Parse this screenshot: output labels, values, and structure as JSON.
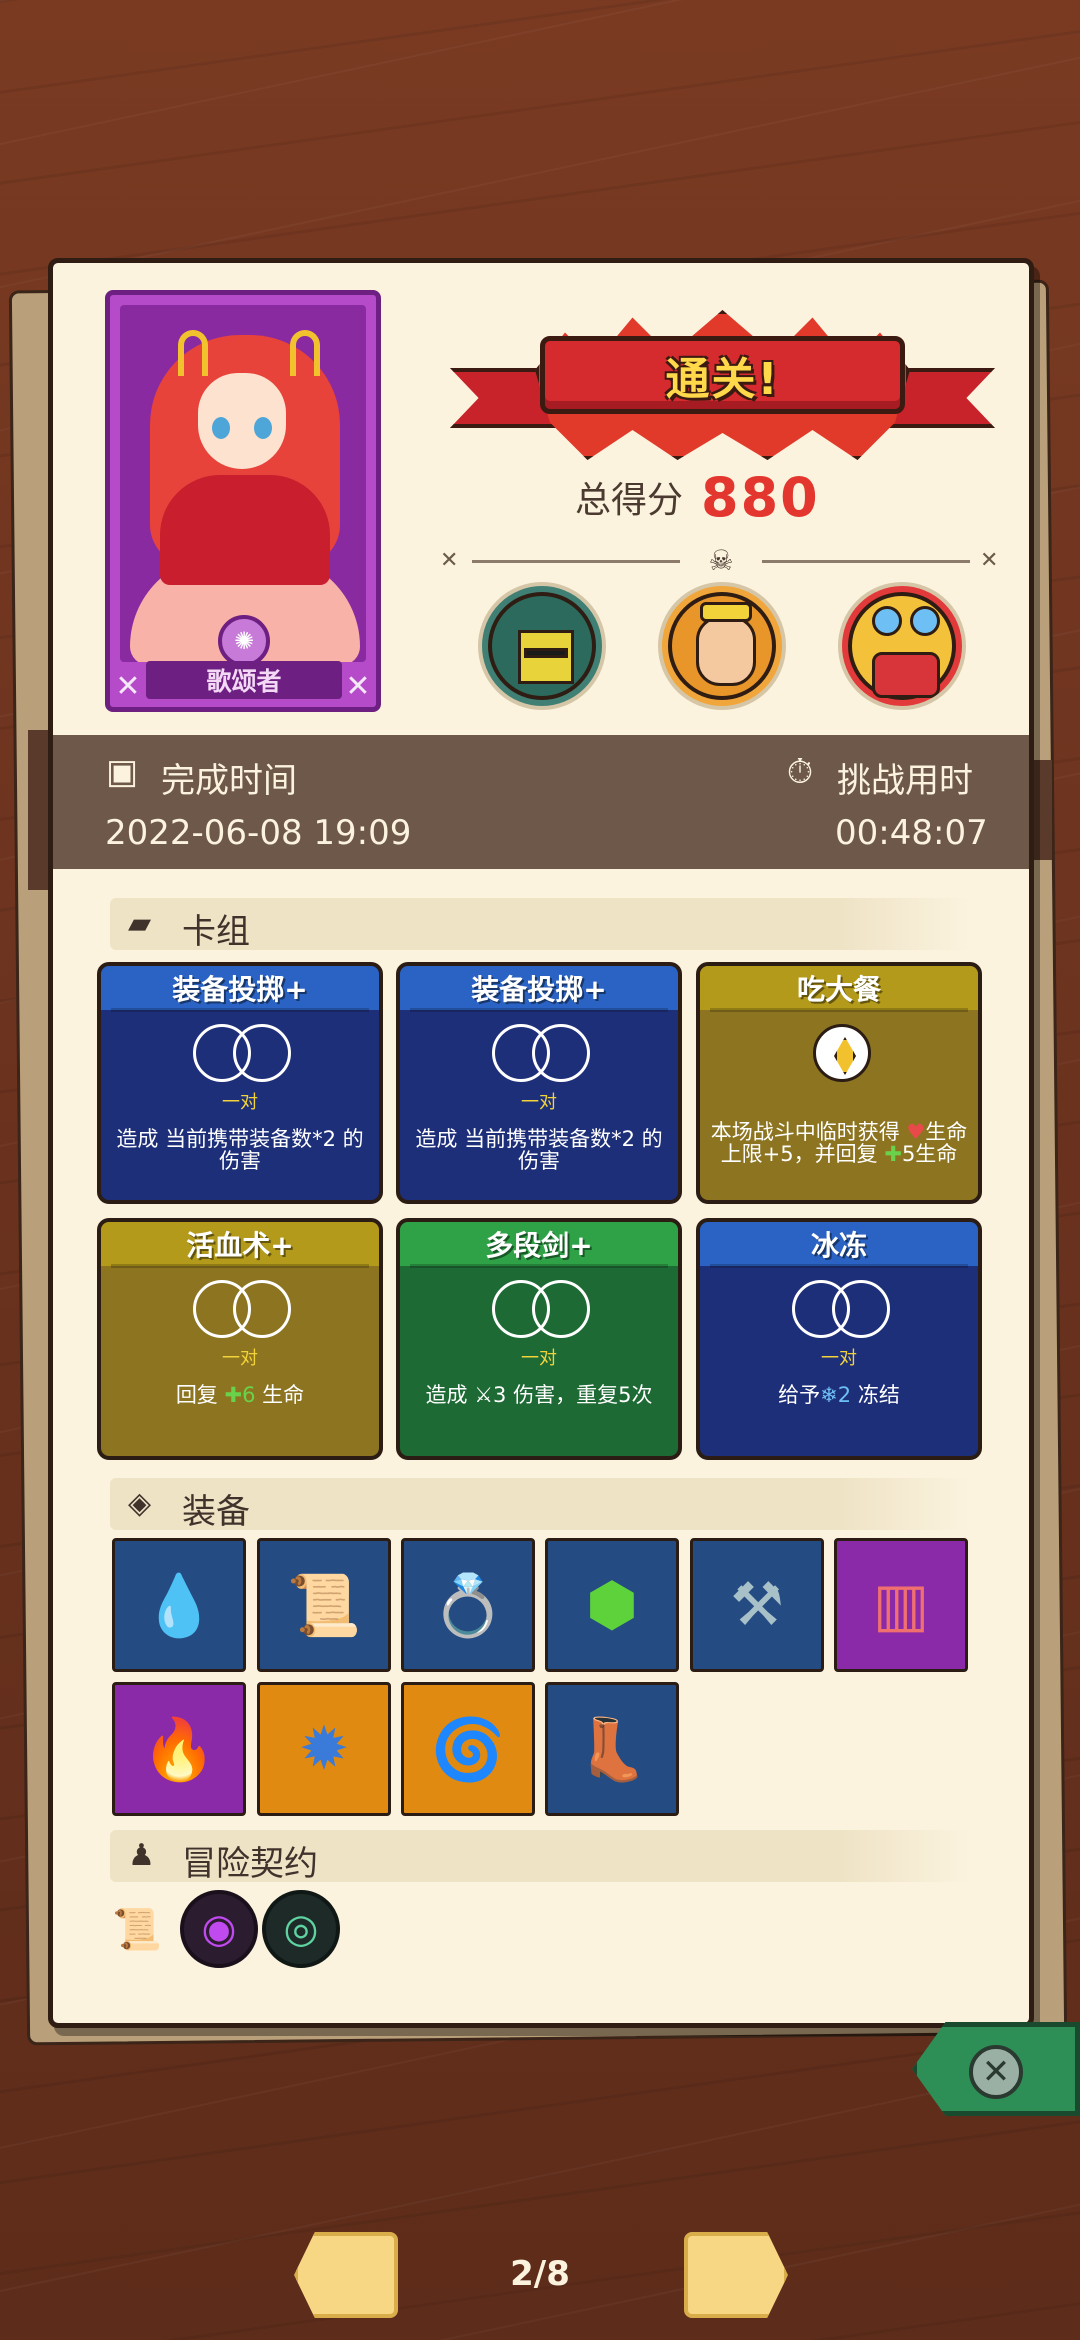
{
  "hero": {
    "name": "歌颂者"
  },
  "result": {
    "banner": "通关!",
    "score_label": "总得分",
    "score_value": "880"
  },
  "bosses": [
    "knight-boss",
    "lion-boss",
    "beast-boss"
  ],
  "timebar": {
    "complete_label": "完成时间",
    "complete_value": "2022-06-08 19:09",
    "challenge_label": "挑战用时",
    "challenge_value": "00:48:07"
  },
  "sections": {
    "deck": "卡组",
    "equipment": "装备",
    "contract": "冒险契约"
  },
  "cards": [
    {
      "title": "装备投掷+",
      "pair": "一对",
      "desc": "造成 当前携带装备数*2 的伤害",
      "color": "blue"
    },
    {
      "title": "装备投掷+",
      "pair": "一对",
      "desc": "造成 当前携带装备数*2 的伤害",
      "color": "blue"
    },
    {
      "title": "吃大餐",
      "desc_a": "本场战斗中临时获得 ",
      "desc_b": "生命上限+5，并回复 ",
      "desc_c": "5生命",
      "color": "gold"
    },
    {
      "title": "活血术+",
      "pair": "一对",
      "desc_a": "回复 ",
      "desc_b": "6",
      "desc_c": " 生命",
      "color": "gold"
    },
    {
      "title": "多段剑+",
      "pair": "一对",
      "desc_a": "造成 ",
      "desc_b": "3 伤害，重复5次",
      "color": "green"
    },
    {
      "title": "冰冻",
      "pair": "一对",
      "desc_a": "给予",
      "desc_b": "2",
      "desc_c": " 冻结",
      "color": "blue"
    }
  ],
  "equipment": [
    "water-drop",
    "scroll",
    "ring",
    "emerald",
    "scythe",
    "pillar",
    "flame",
    "spiked-ball",
    "horn",
    "boot"
  ],
  "contracts": [
    "scroll-contract",
    "purple-eye-contract",
    "green-ring-contract"
  ],
  "pager": "2/8",
  "colors": {
    "paper": "#fbf3de",
    "score": "#e2362e",
    "banner": "#d52a2e"
  }
}
